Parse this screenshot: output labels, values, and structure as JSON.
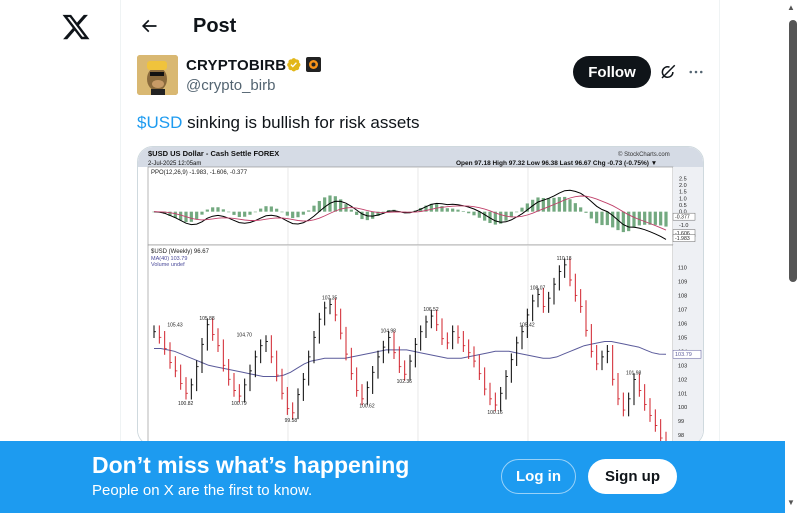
{
  "header": {
    "title": "Post"
  },
  "post": {
    "author": {
      "display_name": "CRYPTOBIRB",
      "handle": "@crypto_birb"
    },
    "follow_label": "Follow",
    "text": {
      "cashtag": "$USD",
      "rest": " sinking is bullish for risk assets"
    }
  },
  "chart_image": {
    "title_left": "$USD US Dollar - Cash Settle FOREX",
    "date_label": "2-Jul-2025 12:05am",
    "source": "© StockCharts.com",
    "quote_bar": "Open 97.18   High 97.32   Low 96.38   Last 96.67   Chg -0.73 (-0.75%) ▼",
    "ppo_label": "PPO(12,26,9) -1.983, -1.606, -0.377",
    "price_label": "$USD (Weekly) 96.67",
    "ma_label": "MA(40) 103.79",
    "volume_label": "Volume undef",
    "ppo_ticks": [
      "2.5",
      "2.0",
      "1.5",
      "1.0",
      "0.5",
      "0.0",
      "-0.5",
      "-1.0",
      "-1.5"
    ],
    "ppo_boxes": [
      "-0.377",
      "-1.606",
      "-1.983"
    ],
    "price_ticks": [
      "110",
      "109",
      "108",
      "107",
      "106",
      "105",
      "104",
      "103",
      "102",
      "101",
      "100",
      "99",
      "98"
    ],
    "ma_box": "103.79",
    "annotations": {
      "a1": "105.43",
      "a2": "105.88",
      "a3": "104.70",
      "a4": "107.35",
      "a5": "104.98",
      "a6": "106.52",
      "a7": "105.42",
      "a8": "108.07",
      "a9": "110.18",
      "a10": "101.98",
      "b1": "100.82",
      "b2": "100.79",
      "b3": "99.58",
      "b4": "100.62",
      "b5": "102.36",
      "b6": "100.16"
    },
    "series": {
      "price_weekly": [
        105.4,
        105.0,
        104.2,
        103.2,
        102.6,
        101.7,
        101.0,
        101.6,
        102.9,
        104.5,
        105.9,
        105.2,
        104.4,
        103.0,
        102.0,
        101.2,
        100.8,
        101.6,
        102.6,
        103.6,
        104.4,
        104.7,
        103.6,
        102.3,
        101.0,
        99.9,
        99.6,
        100.9,
        102.0,
        103.6,
        105.0,
        106.3,
        107.1,
        107.35,
        106.6,
        105.3,
        103.8,
        102.4,
        101.2,
        100.6,
        101.4,
        102.5,
        103.6,
        104.3,
        104.98,
        103.9,
        102.9,
        102.36,
        103.3,
        104.5,
        105.4,
        106.1,
        106.52,
        105.9,
        104.9,
        104.6,
        105.4,
        105.0,
        104.4,
        103.9,
        103.3,
        102.4,
        101.3,
        100.6,
        100.16,
        101.0,
        102.2,
        103.4,
        104.6,
        105.4,
        106.6,
        107.6,
        108.07,
        107.2,
        107.8,
        108.8,
        109.7,
        110.18,
        109.1,
        108.0,
        107.2,
        105.5,
        104.0,
        103.1,
        103.6,
        104.0,
        102.0,
        100.6,
        99.8,
        100.6,
        101.98,
        101.2,
        100.2,
        99.4,
        98.7,
        97.8,
        96.67
      ],
      "ma40": [
        104.2,
        104.2,
        104.1,
        104.0,
        103.8,
        103.6,
        103.4,
        103.2,
        103.0,
        102.9,
        102.8,
        102.7,
        102.6,
        102.5,
        102.4,
        102.3,
        102.2,
        102.2,
        102.2,
        102.3,
        102.5,
        102.8,
        103.1,
        103.3,
        103.4,
        103.5,
        103.5,
        103.5,
        103.5,
        103.6,
        103.7,
        103.8,
        103.9,
        104.0,
        104.1,
        104.1,
        104.1,
        104.1,
        104.0,
        103.9,
        103.8,
        103.7,
        103.6,
        103.5,
        103.5,
        103.5,
        103.6,
        103.7,
        103.8,
        103.9,
        104.0,
        104.0,
        104.0,
        103.9,
        103.8,
        103.7,
        103.6,
        103.5,
        103.5,
        103.6,
        103.8,
        104.0,
        104.2,
        104.4,
        104.5,
        104.6,
        104.7,
        104.7,
        104.6,
        104.5,
        104.4,
        104.3,
        104.1,
        103.9,
        103.8,
        103.79
      ]
    }
  },
  "banner": {
    "title": "Don’t miss what’s happening",
    "subtitle": "People on X are the first to know.",
    "login_label": "Log in",
    "signup_label": "Sign up"
  }
}
